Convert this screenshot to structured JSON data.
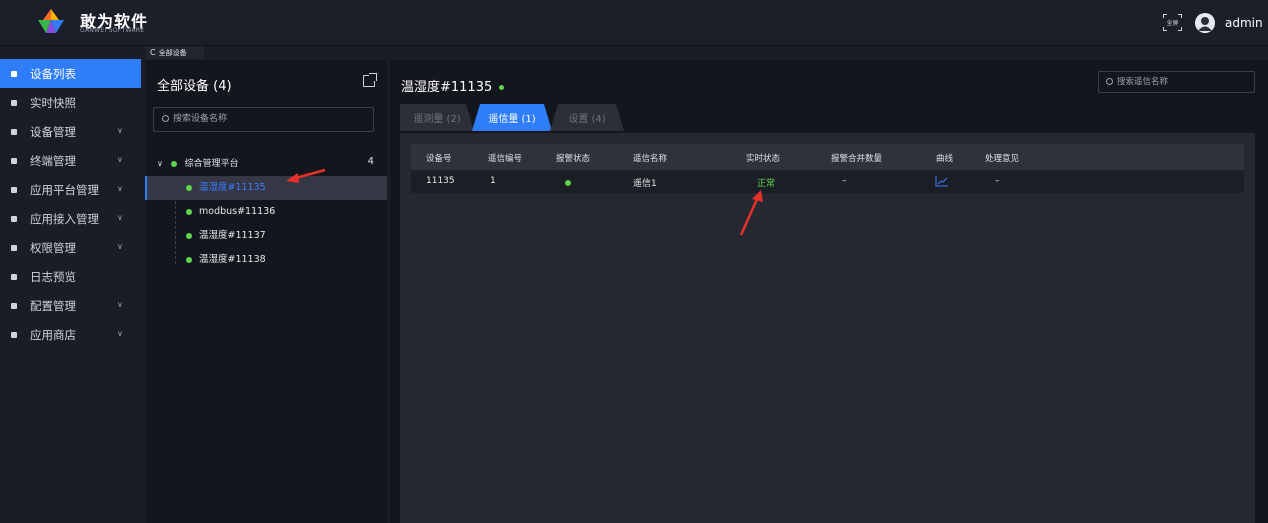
{
  "header": {
    "brand_cn": "敢为软件",
    "brand_en": "GANWEI SOFTWARE",
    "fullscreen_label": "全屏",
    "user": "admin"
  },
  "sidebar": {
    "items": [
      {
        "label": "设备列表",
        "active": true,
        "expandable": false
      },
      {
        "label": "实时快照",
        "active": false,
        "expandable": false
      },
      {
        "label": "设备管理",
        "active": false,
        "expandable": true
      },
      {
        "label": "终端管理",
        "active": false,
        "expandable": true
      },
      {
        "label": "应用平台管理",
        "active": false,
        "expandable": true
      },
      {
        "label": "应用接入管理",
        "active": false,
        "expandable": true
      },
      {
        "label": "权限管理",
        "active": false,
        "expandable": true
      },
      {
        "label": "日志预览",
        "active": false,
        "expandable": false
      },
      {
        "label": "配置管理",
        "active": false,
        "expandable": true
      },
      {
        "label": "应用商店",
        "active": false,
        "expandable": true
      }
    ]
  },
  "subtab": {
    "label": "全部设备"
  },
  "tree": {
    "title": "全部设备 (4)",
    "search_placeholder": "搜索设备名称",
    "root": {
      "label": "综合管理平台",
      "count": "4"
    },
    "nodes": [
      {
        "label": "温湿度#11135",
        "selected": true
      },
      {
        "label": "modbus#11136",
        "selected": false
      },
      {
        "label": "温湿度#11137",
        "selected": false
      },
      {
        "label": "温湿度#11138",
        "selected": false
      }
    ]
  },
  "main": {
    "device_title": "温湿度#11135",
    "search_placeholder": "搜索遥信名称",
    "tabs": [
      {
        "label": "遥测量 (2)",
        "active": false
      },
      {
        "label": "遥信量 (1)",
        "active": true
      },
      {
        "label": "设置 (4)",
        "active": false
      }
    ],
    "table": {
      "headers": [
        "设备号",
        "遥信编号",
        "报警状态",
        "遥信名称",
        "实时状态",
        "报警合并数量",
        "曲线",
        "处理意见"
      ],
      "rows": [
        {
          "device_no": "11135",
          "signal_no": "1",
          "alarm_status": "ok",
          "signal_name": "遥信1",
          "realtime_status": "正常",
          "merge_count": "–",
          "curve": "line-chart-icon",
          "opinion": "–"
        }
      ]
    }
  },
  "colors": {
    "accent": "#2f7dfa",
    "online": "#5fd34e",
    "status_ok": "#5fd34e",
    "annotation": "#e8302a"
  }
}
